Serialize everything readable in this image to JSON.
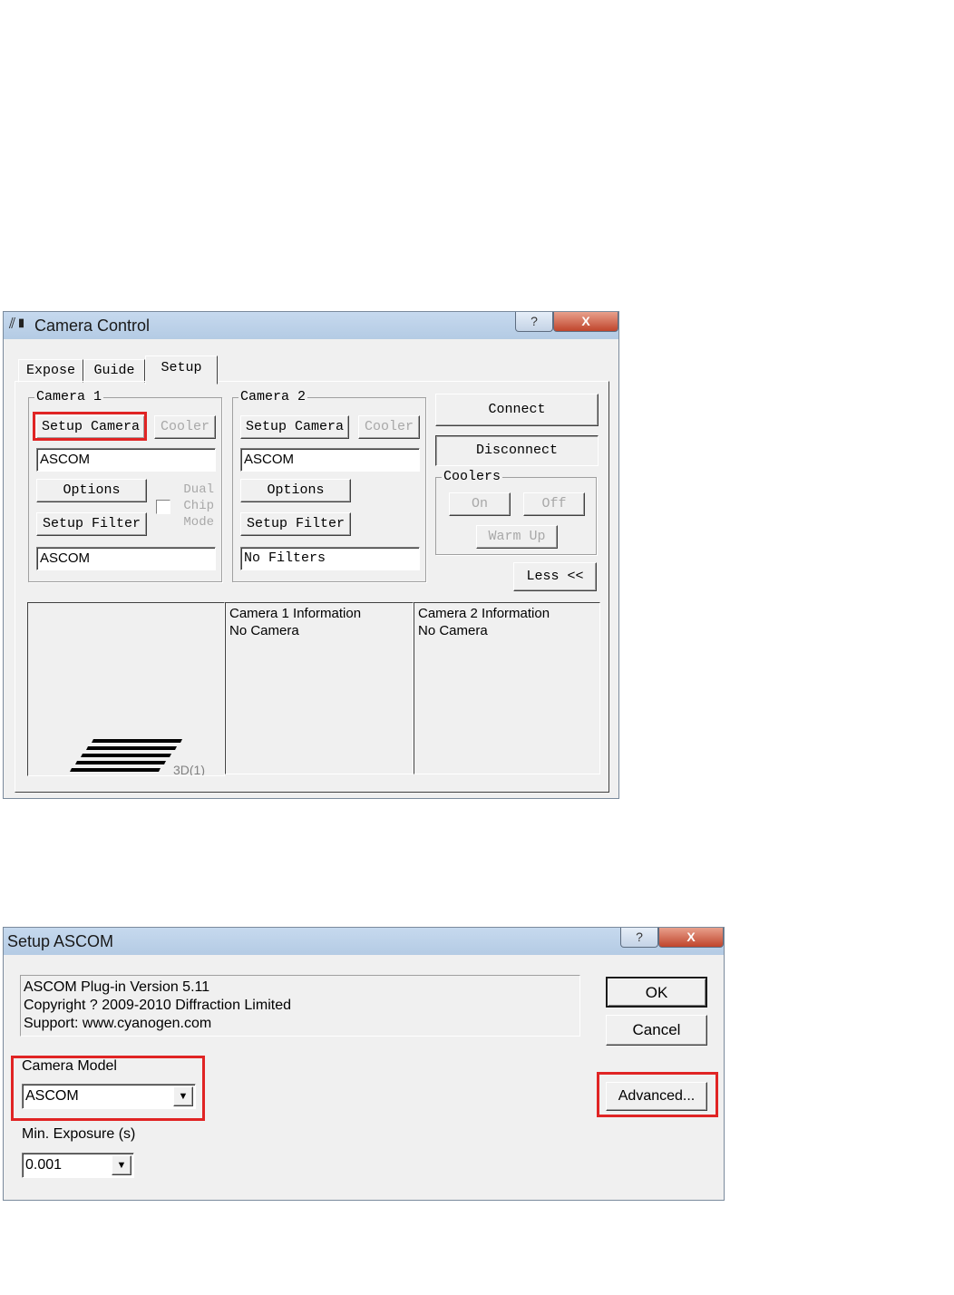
{
  "camera_control": {
    "title": "Camera Control",
    "help_glyph": "?",
    "close_glyph": "X",
    "tabs": [
      "Expose",
      "Guide",
      "Setup"
    ],
    "active_tab": "Setup",
    "camera1": {
      "group_label": "Camera 1",
      "setup_camera": "Setup Camera",
      "cooler": "Cooler",
      "camera_field": "ASCOM",
      "options": "Options",
      "dual_chip_label_1": "Dual",
      "dual_chip_label_2": "Chip",
      "dual_chip_label_3": "Mode",
      "setup_filter": "Setup Filter",
      "filter_field": "ASCOM"
    },
    "camera2": {
      "group_label": "Camera 2",
      "setup_camera": "Setup Camera",
      "cooler": "Cooler",
      "camera_field": "ASCOM",
      "options": "Options",
      "setup_filter": "Setup Filter",
      "filter_field": "No Filters"
    },
    "connect": "Connect",
    "disconnect": "Disconnect",
    "coolers": {
      "group_label": "Coolers",
      "on": "On",
      "off": "Off",
      "warm_up": "Warm Up"
    },
    "less_button": "Less <<",
    "logo_text": "3D(1)",
    "camera1_info": {
      "title": "Camera 1 Information",
      "status": "No Camera"
    },
    "camera2_info": {
      "title": "Camera 2 Information",
      "status": "No Camera"
    }
  },
  "setup_ascom": {
    "title": "Setup ASCOM",
    "help_glyph": "?",
    "close_glyph": "X",
    "info_lines": [
      "ASCOM Plug-in Version 5.11",
      "Copyright ? 2009-2010 Diffraction Limited",
      "Support: www.cyanogen.com"
    ],
    "ok": "OK",
    "cancel": "Cancel",
    "camera_model_label": "Camera Model",
    "camera_model_value": "ASCOM",
    "advanced": "Advanced...",
    "min_exposure_label": "Min. Exposure (s)",
    "min_exposure_value": "0.001"
  },
  "highlight_color": "#e02424"
}
